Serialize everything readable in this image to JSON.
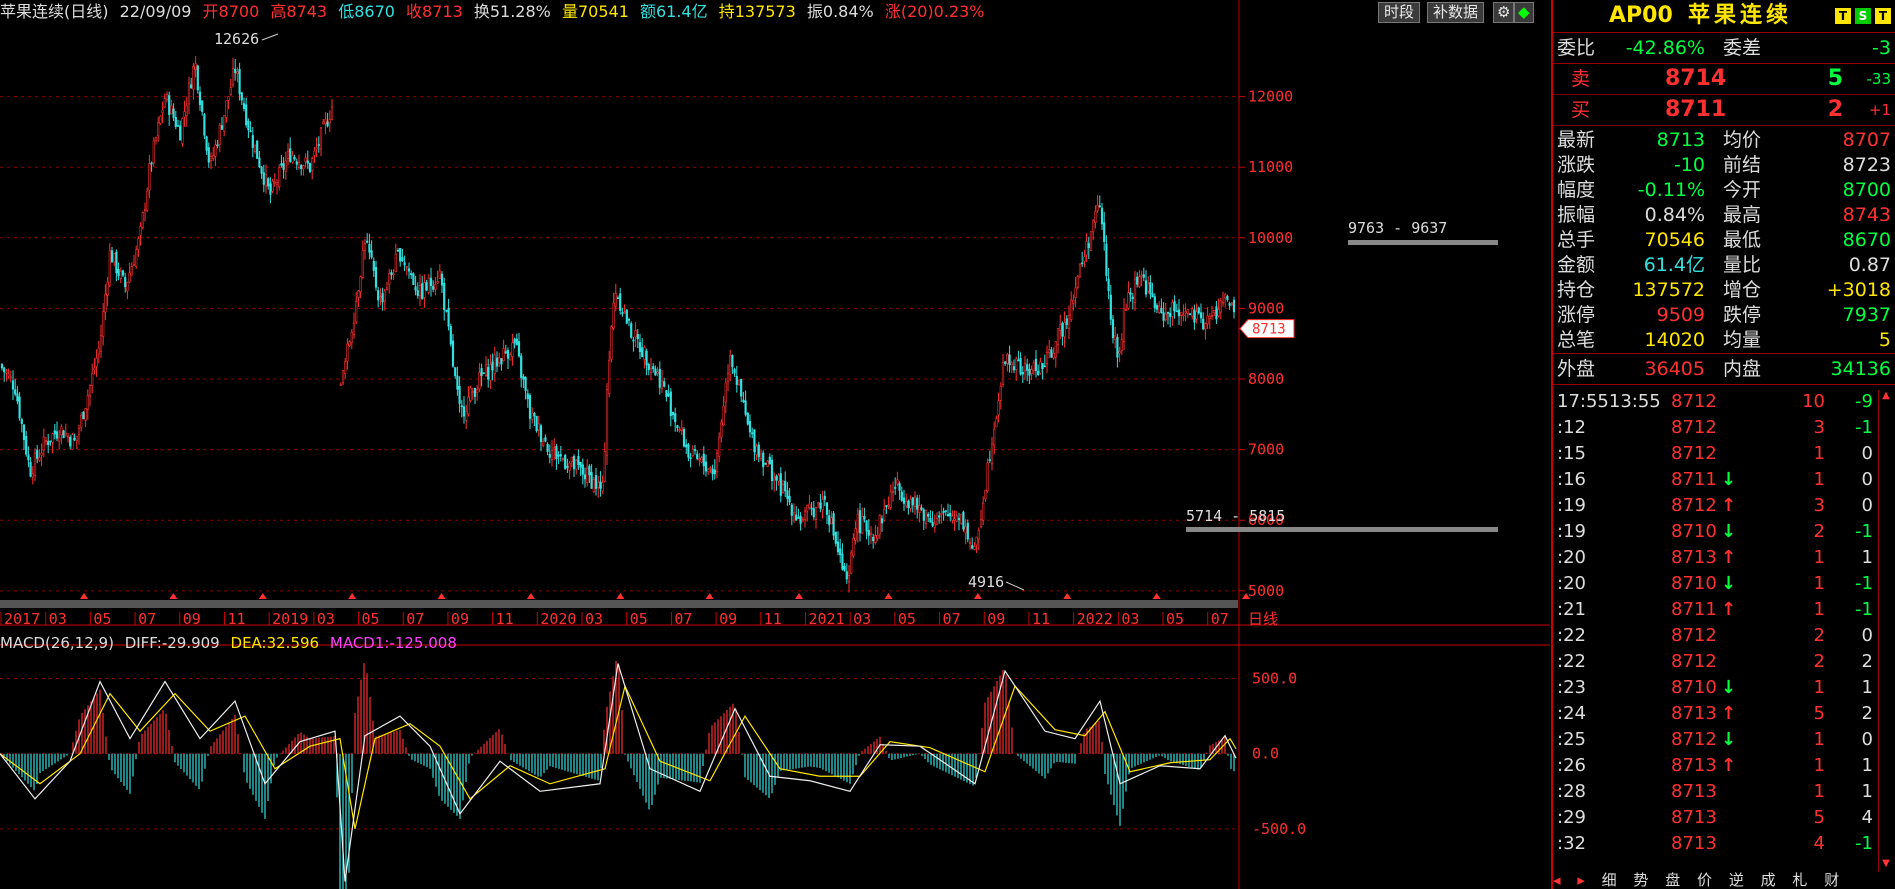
{
  "header": {
    "symbol_title": "苹果连续(日线)",
    "date": "22/09/09",
    "open": "开8700",
    "high": "高8743",
    "low": "低8670",
    "close": "收8713",
    "turnover": "换51.28%",
    "volume": "量70541",
    "amount": "额61.4亿",
    "position": "持137573",
    "amplitude": "振0.84%",
    "change20": "涨(20)0.23%",
    "btn_period": "时段",
    "btn_fill": "补数据",
    "colors": {
      "up": "#ff3030",
      "down": "#33e0e0",
      "yellow": "#ffe600",
      "green": "#00ff40",
      "magenta": "#ff40ff",
      "grid": "#8b0000"
    }
  },
  "chart_data": [
    {
      "type": "candlestick",
      "title": "苹果连续(日线)",
      "y_ticks": [
        5000,
        6000,
        7000,
        8000,
        9000,
        10000,
        11000,
        12000
      ],
      "ylim": [
        4700,
        13000
      ],
      "x_tick_labels": [
        "2017",
        "03",
        "05",
        "07",
        "09",
        "11",
        "2019",
        "03",
        "05",
        "07",
        "09",
        "11",
        "2020",
        "03",
        "05",
        "07",
        "09",
        "11",
        "2021",
        "03",
        "05",
        "07",
        "09",
        "11",
        "2022",
        "03",
        "05",
        "07"
      ],
      "period_label": "日线",
      "annotations": {
        "max_label": "12626",
        "min_label": "4916",
        "last_price_tag": "8713",
        "box_upper": "9763 - 9637",
        "box_lower": "5714 - 5815"
      },
      "close_path": [
        {
          "x": 0,
          "y": 8200
        },
        {
          "x": 15,
          "y": 7900
        },
        {
          "x": 30,
          "y": 6700
        },
        {
          "x": 45,
          "y": 7100
        },
        {
          "x": 60,
          "y": 7300
        },
        {
          "x": 75,
          "y": 7100
        },
        {
          "x": 90,
          "y": 7900
        },
        {
          "x": 100,
          "y": 8500
        },
        {
          "x": 110,
          "y": 9800
        },
        {
          "x": 125,
          "y": 9300
        },
        {
          "x": 140,
          "y": 10000
        },
        {
          "x": 150,
          "y": 11000
        },
        {
          "x": 165,
          "y": 12000
        },
        {
          "x": 180,
          "y": 11500
        },
        {
          "x": 195,
          "y": 12500
        },
        {
          "x": 210,
          "y": 11000
        },
        {
          "x": 225,
          "y": 11800
        },
        {
          "x": 235,
          "y": 12400
        },
        {
          "x": 250,
          "y": 11500
        },
        {
          "x": 270,
          "y": 10600
        },
        {
          "x": 290,
          "y": 11200
        },
        {
          "x": 310,
          "y": 11000
        },
        {
          "x": 333,
          "y": 11900
        },
        {
          "x": 340,
          "y": 7800
        },
        {
          "x": 355,
          "y": 9000
        },
        {
          "x": 365,
          "y": 10000
        },
        {
          "x": 380,
          "y": 9100
        },
        {
          "x": 400,
          "y": 9800
        },
        {
          "x": 420,
          "y": 9200
        },
        {
          "x": 440,
          "y": 9500
        },
        {
          "x": 460,
          "y": 7500
        },
        {
          "x": 480,
          "y": 8000
        },
        {
          "x": 500,
          "y": 8300
        },
        {
          "x": 515,
          "y": 8500
        },
        {
          "x": 530,
          "y": 7500
        },
        {
          "x": 550,
          "y": 7000
        },
        {
          "x": 570,
          "y": 6800
        },
        {
          "x": 590,
          "y": 6600
        },
        {
          "x": 603,
          "y": 6400
        },
        {
          "x": 607,
          "y": 7900
        },
        {
          "x": 615,
          "y": 9300
        },
        {
          "x": 630,
          "y": 8700
        },
        {
          "x": 660,
          "y": 8000
        },
        {
          "x": 690,
          "y": 6900
        },
        {
          "x": 715,
          "y": 6700
        },
        {
          "x": 730,
          "y": 8400
        },
        {
          "x": 750,
          "y": 7200
        },
        {
          "x": 775,
          "y": 6600
        },
        {
          "x": 800,
          "y": 6000
        },
        {
          "x": 825,
          "y": 6300
        },
        {
          "x": 848,
          "y": 5000
        },
        {
          "x": 855,
          "y": 6000
        },
        {
          "x": 875,
          "y": 5800
        },
        {
          "x": 895,
          "y": 6500
        },
        {
          "x": 915,
          "y": 6200
        },
        {
          "x": 935,
          "y": 6000
        },
        {
          "x": 960,
          "y": 6100
        },
        {
          "x": 975,
          "y": 5500
        },
        {
          "x": 990,
          "y": 7000
        },
        {
          "x": 1005,
          "y": 8300
        },
        {
          "x": 1025,
          "y": 8100
        },
        {
          "x": 1045,
          "y": 8200
        },
        {
          "x": 1065,
          "y": 8800
        },
        {
          "x": 1085,
          "y": 9800
        },
        {
          "x": 1100,
          "y": 10500
        },
        {
          "x": 1110,
          "y": 9000
        },
        {
          "x": 1118,
          "y": 8200
        },
        {
          "x": 1125,
          "y": 9000
        },
        {
          "x": 1140,
          "y": 9500
        },
        {
          "x": 1160,
          "y": 8900
        },
        {
          "x": 1180,
          "y": 9000
        },
        {
          "x": 1200,
          "y": 8800
        },
        {
          "x": 1215,
          "y": 8900
        },
        {
          "x": 1228,
          "y": 9200
        },
        {
          "x": 1236,
          "y": 8713
        }
      ]
    },
    {
      "type": "bar",
      "title": "MACD(26,12,9)",
      "y_ticks": [
        "500.0",
        "0.0",
        "-500.0"
      ],
      "ylim": [
        -900,
        650
      ],
      "diff_label": "DIFF:-29.909",
      "dea_label": "DEA:32.596",
      "macd_label": "MACD1:-125.008",
      "diff_path": [
        {
          "x": 0,
          "y": 0
        },
        {
          "x": 35,
          "y": -300
        },
        {
          "x": 70,
          "y": -50
        },
        {
          "x": 100,
          "y": 480
        },
        {
          "x": 130,
          "y": 100
        },
        {
          "x": 165,
          "y": 480
        },
        {
          "x": 200,
          "y": 100
        },
        {
          "x": 235,
          "y": 350
        },
        {
          "x": 265,
          "y": -200
        },
        {
          "x": 300,
          "y": 80
        },
        {
          "x": 335,
          "y": 150
        },
        {
          "x": 345,
          "y": -850
        },
        {
          "x": 365,
          "y": 120
        },
        {
          "x": 400,
          "y": 250
        },
        {
          "x": 430,
          "y": 50
        },
        {
          "x": 460,
          "y": -400
        },
        {
          "x": 500,
          "y": -50
        },
        {
          "x": 540,
          "y": -250
        },
        {
          "x": 600,
          "y": -200
        },
        {
          "x": 618,
          "y": 600
        },
        {
          "x": 650,
          "y": -100
        },
        {
          "x": 700,
          "y": -250
        },
        {
          "x": 735,
          "y": 300
        },
        {
          "x": 770,
          "y": -150
        },
        {
          "x": 810,
          "y": -180
        },
        {
          "x": 850,
          "y": -250
        },
        {
          "x": 880,
          "y": 60
        },
        {
          "x": 920,
          "y": 50
        },
        {
          "x": 975,
          "y": -200
        },
        {
          "x": 1005,
          "y": 550
        },
        {
          "x": 1045,
          "y": 150
        },
        {
          "x": 1075,
          "y": 100
        },
        {
          "x": 1100,
          "y": 350
        },
        {
          "x": 1120,
          "y": -200
        },
        {
          "x": 1160,
          "y": -80
        },
        {
          "x": 1200,
          "y": -100
        },
        {
          "x": 1225,
          "y": 120
        },
        {
          "x": 1236,
          "y": -30
        }
      ],
      "dea_path": [
        {
          "x": 0,
          "y": 0
        },
        {
          "x": 40,
          "y": -200
        },
        {
          "x": 80,
          "y": 0
        },
        {
          "x": 110,
          "y": 400
        },
        {
          "x": 140,
          "y": 150
        },
        {
          "x": 175,
          "y": 400
        },
        {
          "x": 210,
          "y": 150
        },
        {
          "x": 245,
          "y": 250
        },
        {
          "x": 275,
          "y": -100
        },
        {
          "x": 310,
          "y": 50
        },
        {
          "x": 340,
          "y": 100
        },
        {
          "x": 355,
          "y": -500
        },
        {
          "x": 375,
          "y": 100
        },
        {
          "x": 410,
          "y": 200
        },
        {
          "x": 440,
          "y": 50
        },
        {
          "x": 470,
          "y": -300
        },
        {
          "x": 510,
          "y": -80
        },
        {
          "x": 550,
          "y": -200
        },
        {
          "x": 605,
          "y": -100
        },
        {
          "x": 625,
          "y": 450
        },
        {
          "x": 660,
          "y": -50
        },
        {
          "x": 710,
          "y": -180
        },
        {
          "x": 745,
          "y": 250
        },
        {
          "x": 780,
          "y": -100
        },
        {
          "x": 820,
          "y": -150
        },
        {
          "x": 860,
          "y": -150
        },
        {
          "x": 890,
          "y": 80
        },
        {
          "x": 930,
          "y": 40
        },
        {
          "x": 985,
          "y": -120
        },
        {
          "x": 1015,
          "y": 450
        },
        {
          "x": 1055,
          "y": 160
        },
        {
          "x": 1085,
          "y": 120
        },
        {
          "x": 1105,
          "y": 280
        },
        {
          "x": 1130,
          "y": -120
        },
        {
          "x": 1170,
          "y": -60
        },
        {
          "x": 1210,
          "y": -40
        },
        {
          "x": 1230,
          "y": 100
        },
        {
          "x": 1236,
          "y": 33
        }
      ]
    }
  ],
  "right_panel": {
    "code": "AP00",
    "name": "苹果连续",
    "icons": [
      "T",
      "S",
      "T"
    ],
    "wei_bi_label": "委比",
    "wei_bi": "-42.86%",
    "wei_cha_label": "委差",
    "wei_cha": "-3",
    "sell": {
      "label": "卖",
      "price": "8714",
      "vol": "5",
      "chg": "-33"
    },
    "buy": {
      "label": "买",
      "price": "8711",
      "vol": "2",
      "chg": "+1"
    },
    "stats": [
      {
        "l1": "最新",
        "v1": "8713",
        "c1": "#00ff40",
        "l2": "均价",
        "v2": "8707",
        "c2": "#ff3030"
      },
      {
        "l1": "涨跌",
        "v1": "-10",
        "c1": "#00ff40",
        "l2": "前结",
        "v2": "8723",
        "c2": "#dddddd"
      },
      {
        "l1": "幅度",
        "v1": "-0.11%",
        "c1": "#00ff40",
        "l2": "今开",
        "v2": "8700",
        "c2": "#00ff40"
      },
      {
        "l1": "振幅",
        "v1": "0.84%",
        "c1": "#dddddd",
        "l2": "最高",
        "v2": "8743",
        "c2": "#ff3030"
      },
      {
        "l1": "总手",
        "v1": "70546",
        "c1": "#ffe600",
        "l2": "最低",
        "v2": "8670",
        "c2": "#00ff40"
      },
      {
        "l1": "金额",
        "v1": "61.4亿",
        "c1": "#33e0e0",
        "l2": "量比",
        "v2": "0.87",
        "c2": "#dddddd"
      },
      {
        "l1": "持仓",
        "v1": "137572",
        "c1": "#ffe600",
        "l2": "增仓",
        "v2": "+3018",
        "c2": "#ffe600"
      },
      {
        "l1": "涨停",
        "v1": "9509",
        "c1": "#ff3030",
        "l2": "跌停",
        "v2": "7937",
        "c2": "#00ff40"
      },
      {
        "l1": "总笔",
        "v1": "14020",
        "c1": "#ffe600",
        "l2": "均量",
        "v2": "5",
        "c2": "#ffe600"
      }
    ],
    "waipan_label": "外盘",
    "waipan": "36405",
    "neipan_label": "内盘",
    "neipan": "34136",
    "ticks": [
      {
        "t": "17:5513:55",
        "p": "8712",
        "a": "",
        "q": "10",
        "c": "-9"
      },
      {
        "t": ":12",
        "p": "8712",
        "a": "",
        "q": "3",
        "c": "-1"
      },
      {
        "t": ":15",
        "p": "8712",
        "a": "",
        "q": "1",
        "c": "0"
      },
      {
        "t": ":16",
        "p": "8711",
        "a": "down",
        "q": "1",
        "c": "0"
      },
      {
        "t": ":19",
        "p": "8712",
        "a": "up",
        "q": "3",
        "c": "0"
      },
      {
        "t": ":19",
        "p": "8710",
        "a": "down",
        "q": "2",
        "c": "-1"
      },
      {
        "t": ":20",
        "p": "8713",
        "a": "up",
        "q": "1",
        "c": "1"
      },
      {
        "t": ":20",
        "p": "8710",
        "a": "down",
        "q": "1",
        "c": "-1"
      },
      {
        "t": ":21",
        "p": "8711",
        "a": "up",
        "q": "1",
        "c": "-1"
      },
      {
        "t": ":22",
        "p": "8712",
        "a": "",
        "q": "2",
        "c": "0"
      },
      {
        "t": ":22",
        "p": "8712",
        "a": "",
        "q": "2",
        "c": "2"
      },
      {
        "t": ":23",
        "p": "8710",
        "a": "down",
        "q": "1",
        "c": "1"
      },
      {
        "t": ":24",
        "p": "8713",
        "a": "up",
        "q": "5",
        "c": "2"
      },
      {
        "t": ":25",
        "p": "8712",
        "a": "down",
        "q": "1",
        "c": "0"
      },
      {
        "t": ":26",
        "p": "8713",
        "a": "up",
        "q": "1",
        "c": "1"
      },
      {
        "t": ":28",
        "p": "8713",
        "a": "",
        "q": "1",
        "c": "1"
      },
      {
        "t": ":29",
        "p": "8713",
        "a": "",
        "q": "5",
        "c": "4"
      },
      {
        "t": ":32",
        "p": "8713",
        "a": "",
        "q": "4",
        "c": "-1"
      }
    ],
    "bottom_tabs": [
      "细",
      "势",
      "盘",
      "价",
      "逆",
      "成",
      "札",
      "财"
    ]
  }
}
